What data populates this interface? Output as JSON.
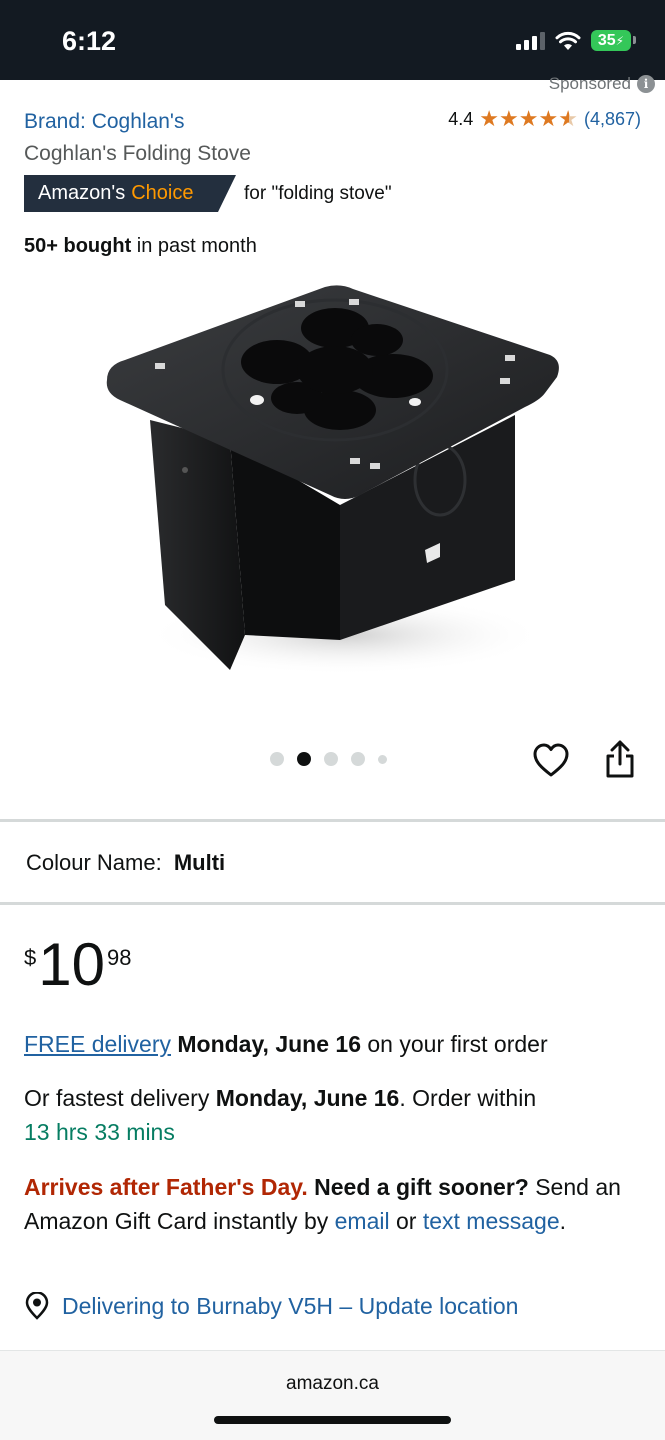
{
  "status_bar": {
    "time": "6:12",
    "battery": "35"
  },
  "sponsored_label": "Sponsored",
  "brand": {
    "label": "Brand: Coghlan's"
  },
  "rating": {
    "value": "4.4",
    "stars": 4.4,
    "count": "(4,867)"
  },
  "product_title": "Coghlan's Folding Stove",
  "choice": {
    "prefix": "Amazon's",
    "highlight": "Choice",
    "for_text": "for \"folding stove\""
  },
  "bought": {
    "bold": "50+ bought",
    "rest": " in past month"
  },
  "image_carousel": {
    "count": 5,
    "active_index": 1
  },
  "colour": {
    "label": "Colour Name:",
    "value": "Multi"
  },
  "price": {
    "symbol": "$",
    "whole": "10",
    "fraction": "98"
  },
  "delivery": {
    "free_link": "FREE delivery",
    "date": "Monday, June 16",
    "suffix": " on your first order",
    "fastest_prefix": "Or fastest delivery ",
    "fastest_date": "Monday, June 16",
    "order_within": ". Order within ",
    "countdown": "13 hrs 33 mins"
  },
  "gift_notice": {
    "warning": "Arrives after Father's Day.",
    "question": "Need a gift sooner?",
    "text1": " Send an Amazon Gift Card instantly by ",
    "email_link": "email",
    "text2": " or ",
    "text_link": "text message",
    "text3": "."
  },
  "location": {
    "label": "Delivering to Burnaby V5H – Update location"
  },
  "browser": {
    "url": "amazon.ca"
  },
  "colors": {
    "link": "#2162a1",
    "star": "#de7921",
    "badge": "#232f3e",
    "choice_orange": "#ff9900",
    "green": "#067d62",
    "red": "#b12704"
  }
}
